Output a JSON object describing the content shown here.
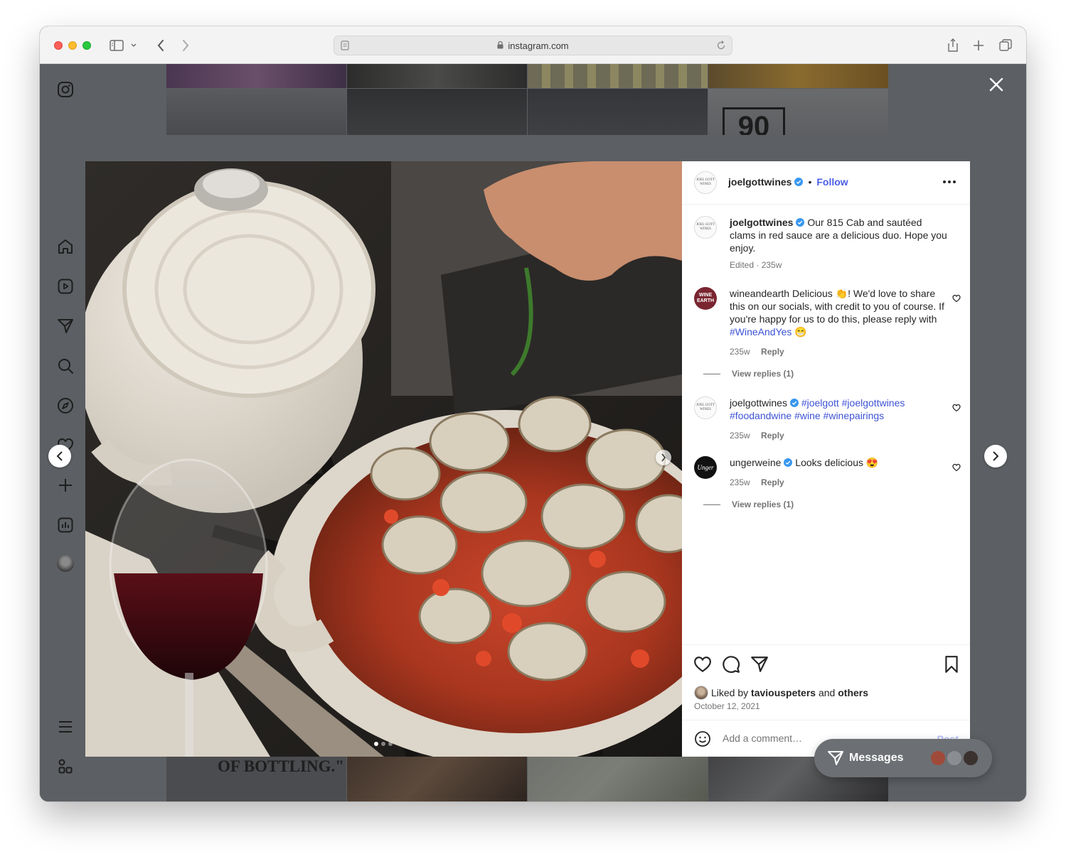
{
  "browser": {
    "url": "instagram.com"
  },
  "post": {
    "author": "joelgottwines",
    "follow_label": "Follow",
    "author_avatar_text": [
      "JOEL GOTT",
      "WINES"
    ],
    "caption": {
      "username": "joelgottwines",
      "text": "Our 815 Cab and sautéed clams in red sauce are a delicious duo. Hope you enjoy.",
      "meta": "Edited · 235w"
    },
    "comments": [
      {
        "username": "wineandearth",
        "avatar_text": "WINE EARTH",
        "text": "Delicious 👏! We'd love to share this on our socials, with credit to you of course. If you're happy for us to do this, please reply with",
        "hashtag": "#WineAndYes",
        "emoji": "😁",
        "time": "235w",
        "reply": "Reply",
        "view_replies": "View replies (1)"
      },
      {
        "username": "joelgottwines",
        "hashtags": "#joelgott #joelgottwines #foodandwine #wine #winepairings",
        "time": "235w",
        "reply": "Reply"
      },
      {
        "username": "ungerweine",
        "avatar_text": "Unger",
        "text": "Looks delicious 😍",
        "time": "235w",
        "reply": "Reply",
        "view_replies": "View replies (1)"
      }
    ],
    "liked_by_prefix": "Liked by",
    "liked_by_user": "taviouspeters",
    "liked_by_and": "and",
    "liked_by_others": "others",
    "date": "October 12, 2021",
    "add_comment_placeholder": "Add a comment…",
    "post_label": "Post",
    "carousel": {
      "count": 3,
      "active": 1
    }
  },
  "messages": {
    "label": "Messages"
  },
  "grid_text": {
    "tile_poster": "THE TASTE AT THE MOMENT OF BOTTLING.\"",
    "tile_badge": "90"
  },
  "colors": {
    "accent": "#4a5de6",
    "hashtag": "#3d52d5",
    "overlay": "#5c5f63"
  }
}
